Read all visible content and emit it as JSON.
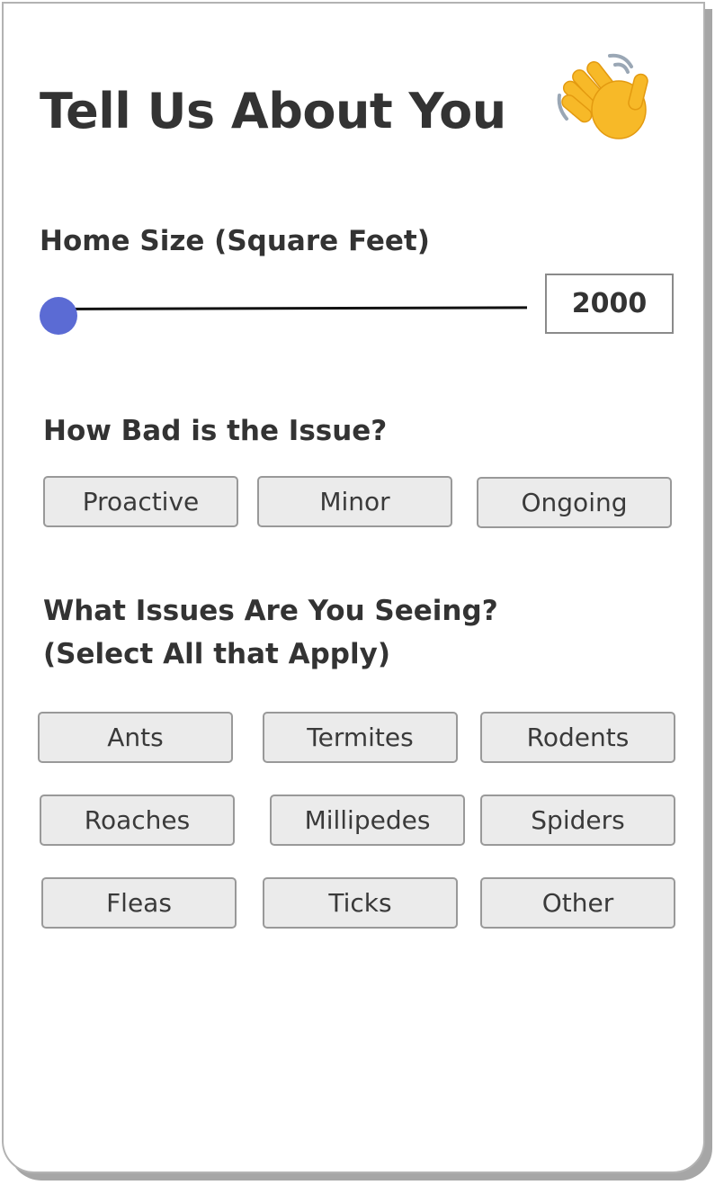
{
  "header": {
    "title": "Tell Us About You",
    "icon": "waving-hand-icon"
  },
  "home_size": {
    "label": "Home Size (Square Feet)",
    "value": "2000",
    "slider_position": 0,
    "handle_color": "#5b6bd4"
  },
  "severity": {
    "label": "How Bad is the Issue?",
    "options": [
      "Proactive",
      "Minor",
      "Ongoing"
    ]
  },
  "issues": {
    "label_line1": "What Issues Are You Seeing?",
    "label_line2": "(Select All that Apply)",
    "options": [
      "Ants",
      "Termites",
      "Rodents",
      "Roaches",
      "Millipedes",
      "Spiders",
      "Fleas",
      "Ticks",
      "Other"
    ]
  },
  "colors": {
    "button_bg": "#ebebeb",
    "button_border": "#999999",
    "text": "#333333"
  }
}
